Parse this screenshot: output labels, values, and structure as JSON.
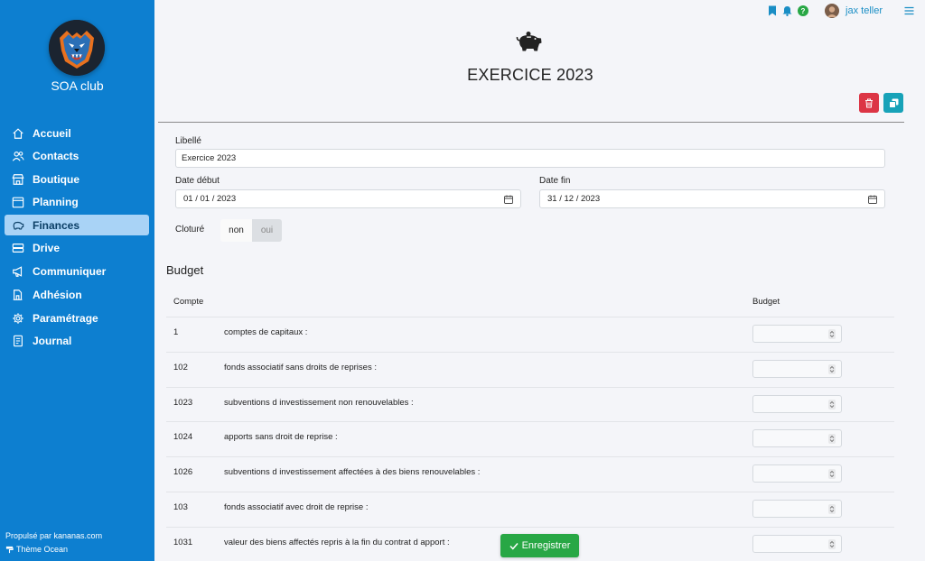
{
  "sidebar": {
    "club_name": "SOA club",
    "items": [
      {
        "label": "Accueil",
        "icon": "home-icon"
      },
      {
        "label": "Contacts",
        "icon": "users-icon"
      },
      {
        "label": "Boutique",
        "icon": "shop-icon"
      },
      {
        "label": "Planning",
        "icon": "calendar-icon"
      },
      {
        "label": "Finances",
        "icon": "piggy-bank-icon",
        "active": true
      },
      {
        "label": "Drive",
        "icon": "drive-icon"
      },
      {
        "label": "Communiquer",
        "icon": "megaphone-icon"
      },
      {
        "label": "Adhésion",
        "icon": "membership-icon"
      },
      {
        "label": "Paramétrage",
        "icon": "gear-icon"
      },
      {
        "label": "Journal",
        "icon": "journal-icon"
      }
    ],
    "powered_by": "Propulsé par kananas.com",
    "theme": "Thème Ocean"
  },
  "topbar": {
    "username": "jax teller"
  },
  "page": {
    "title": "EXERCICE 2023"
  },
  "form": {
    "libelle_label": "Libellé",
    "libelle_value": "Exercice 2023",
    "date_debut_label": "Date début",
    "date_debut_value": "01 / 01 / 2023",
    "date_fin_label": "Date fin",
    "date_fin_value": "31 / 12 / 2023",
    "cloture_label": "Cloturé",
    "cloture_options": [
      "non",
      "oui"
    ],
    "cloture_selected": "non"
  },
  "budget": {
    "title": "Budget",
    "col_compte": "Compte",
    "col_budget": "Budget",
    "rows": [
      {
        "compte": "1",
        "libelle": "comptes de capitaux :"
      },
      {
        "compte": "102",
        "libelle": "fonds associatif sans droits de reprises :"
      },
      {
        "compte": "1023",
        "libelle": "subventions d investissement non renouvelables :"
      },
      {
        "compte": "1024",
        "libelle": "apports sans droit de reprise :"
      },
      {
        "compte": "1026",
        "libelle": "subventions d investissement affectées à des biens renouvelables :"
      },
      {
        "compte": "103",
        "libelle": "fonds associatif avec droit de reprise :"
      },
      {
        "compte": "1031",
        "libelle": "valeur des biens affectés repris à la fin du contrat d apport :"
      }
    ]
  },
  "actions": {
    "save_label": "Enregistrer"
  },
  "colors": {
    "sidebar": "#0d7fd0",
    "active_item": "#a9d3f6",
    "danger": "#dc3545",
    "info": "#17a2b8",
    "success": "#28a745"
  }
}
